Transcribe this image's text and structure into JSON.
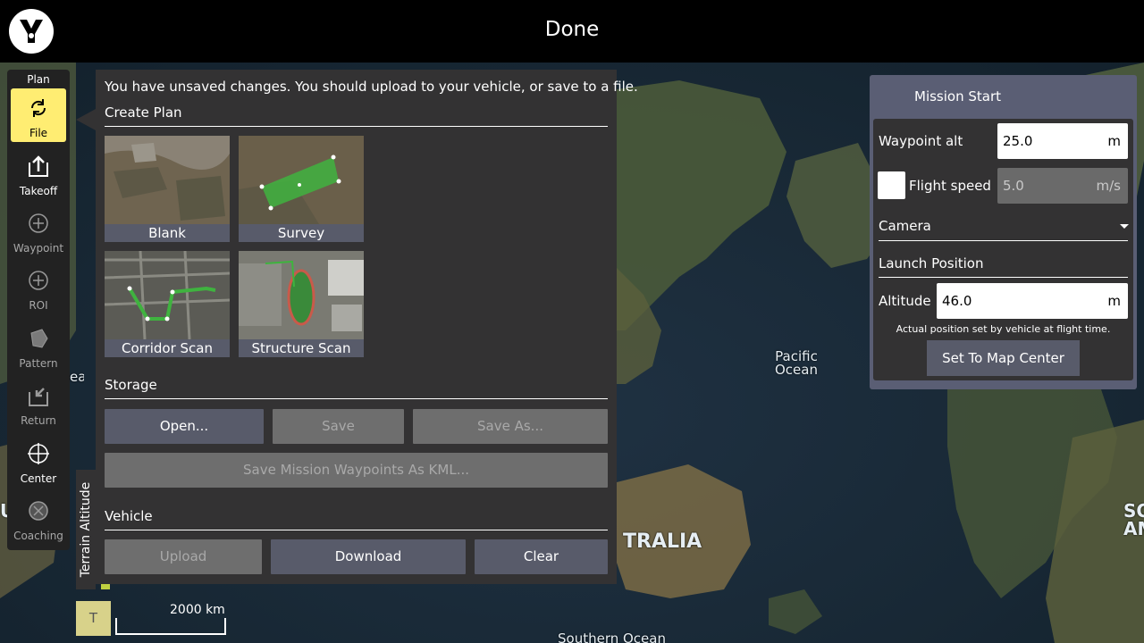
{
  "app": {
    "title": "Done"
  },
  "toolbar": {
    "header": "Plan",
    "items": [
      {
        "label": "File",
        "icon": "file-sync-icon",
        "state": "active"
      },
      {
        "label": "Takeoff",
        "icon": "takeoff-icon",
        "state": "enabled"
      },
      {
        "label": "Waypoint",
        "icon": "plus-circle-icon",
        "state": "disabled"
      },
      {
        "label": "ROI",
        "icon": "plus-circle-icon",
        "state": "disabled"
      },
      {
        "label": "Pattern",
        "icon": "pattern-icon",
        "state": "disabled"
      },
      {
        "label": "Return",
        "icon": "return-icon",
        "state": "disabled"
      },
      {
        "label": "Center",
        "icon": "crosshair-icon",
        "state": "enabled"
      },
      {
        "label": "Coaching",
        "icon": "coaching-icon",
        "state": "disabled"
      }
    ]
  },
  "plan_panel": {
    "message": "You have unsaved changes. You should upload to your vehicle, or save to a file.",
    "create_plan": {
      "heading": "Create Plan",
      "templates": [
        "Blank",
        "Survey",
        "Corridor Scan",
        "Structure Scan"
      ]
    },
    "storage": {
      "heading": "Storage",
      "open": "Open...",
      "save": "Save",
      "save_as": "Save As...",
      "save_kml": "Save Mission Waypoints As KML..."
    },
    "vehicle": {
      "heading": "Vehicle",
      "upload": "Upload",
      "download": "Download",
      "clear": "Clear"
    }
  },
  "terrain": {
    "label": "Terrain Altitude",
    "toggle": "T"
  },
  "scale": {
    "label": "2000 km"
  },
  "mission_start": {
    "heading": "Mission Start",
    "waypoint_alt_label": "Waypoint alt",
    "waypoint_alt_value": "25.0",
    "waypoint_alt_unit": "m",
    "flight_speed_label": "Flight speed",
    "flight_speed_value": "5.0",
    "flight_speed_unit": "m/s",
    "camera_label": "Camera",
    "launch_heading": "Launch Position",
    "altitude_label": "Altitude",
    "altitude_value": "46.0",
    "altitude_unit": "m",
    "note": "Actual position set by vehicle at flight time.",
    "center_button": "Set To Map Center"
  },
  "map": {
    "labels": [
      "Pacific Ocean",
      "TRALIA",
      "Southern Ocean",
      "SO AM",
      "tic Ocean",
      "UTH"
    ]
  }
}
